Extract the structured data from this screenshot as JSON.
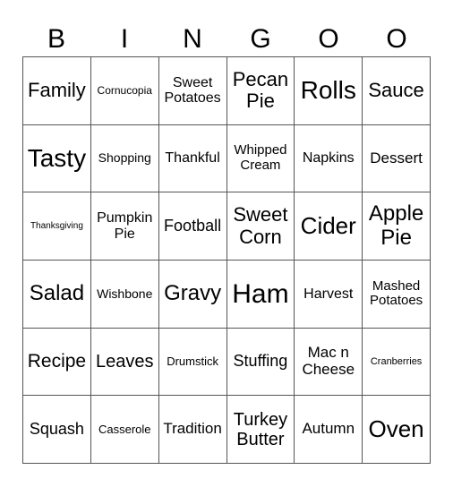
{
  "header": [
    "B",
    "I",
    "N",
    "G",
    "O",
    "O"
  ],
  "cells": [
    [
      {
        "text": "Family",
        "size": 22
      },
      {
        "text": "Cornucopia",
        "size": 12
      },
      {
        "text": "Sweet Potatoes",
        "size": 16
      },
      {
        "text": "Pecan Pie",
        "size": 22
      },
      {
        "text": "Rolls",
        "size": 28
      },
      {
        "text": "Sauce",
        "size": 22
      }
    ],
    [
      {
        "text": "Tasty",
        "size": 28
      },
      {
        "text": "Shopping",
        "size": 14
      },
      {
        "text": "Thankful",
        "size": 16
      },
      {
        "text": "Whipped Cream",
        "size": 15
      },
      {
        "text": "Napkins",
        "size": 16
      },
      {
        "text": "Dessert",
        "size": 17
      }
    ],
    [
      {
        "text": "Thanksgiving",
        "size": 10
      },
      {
        "text": "Pumpkin Pie",
        "size": 16
      },
      {
        "text": "Football",
        "size": 18
      },
      {
        "text": "Sweet Corn",
        "size": 22
      },
      {
        "text": "Cider",
        "size": 26
      },
      {
        "text": "Apple Pie",
        "size": 24
      }
    ],
    [
      {
        "text": "Salad",
        "size": 24
      },
      {
        "text": "Wishbone",
        "size": 14
      },
      {
        "text": "Gravy",
        "size": 24
      },
      {
        "text": "Ham",
        "size": 30
      },
      {
        "text": "Harvest",
        "size": 16
      },
      {
        "text": "Mashed Potatoes",
        "size": 15
      }
    ],
    [
      {
        "text": "Recipe",
        "size": 21
      },
      {
        "text": "Leaves",
        "size": 20
      },
      {
        "text": "Drumstick",
        "size": 13
      },
      {
        "text": "Stuffing",
        "size": 18
      },
      {
        "text": "Mac n Cheese",
        "size": 17
      },
      {
        "text": "Cranberries",
        "size": 11
      }
    ],
    [
      {
        "text": "Squash",
        "size": 18
      },
      {
        "text": "Casserole",
        "size": 13
      },
      {
        "text": "Tradition",
        "size": 17
      },
      {
        "text": "Turkey Butter",
        "size": 20
      },
      {
        "text": "Autumn",
        "size": 17
      },
      {
        "text": "Oven",
        "size": 26
      }
    ]
  ]
}
